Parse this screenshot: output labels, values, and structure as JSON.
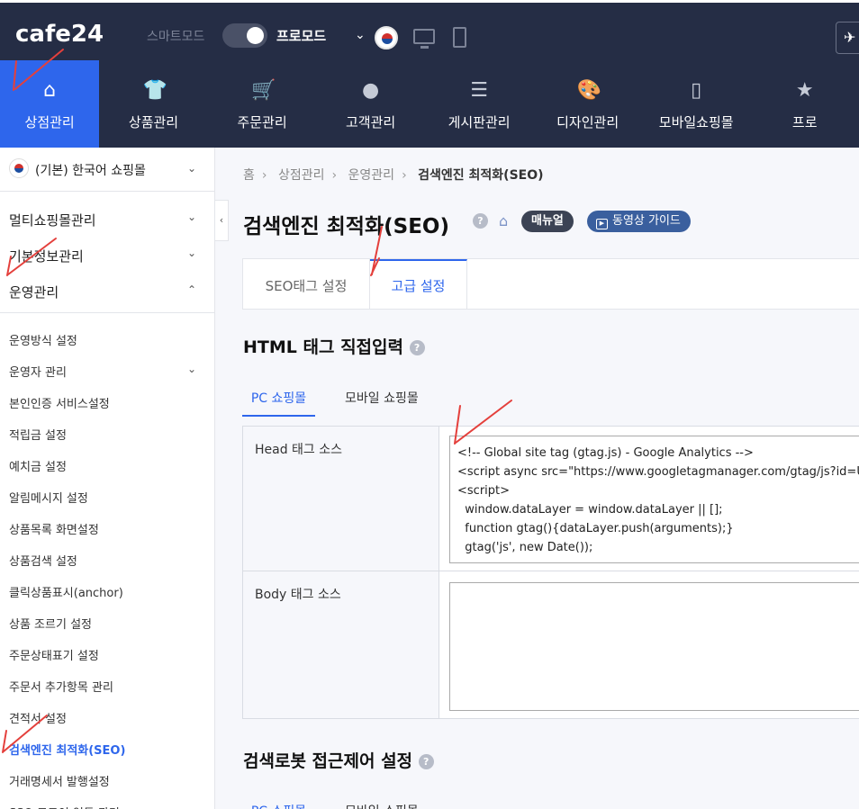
{
  "topbar": {
    "logo": "cafe24",
    "smart_mode": "스마트모드",
    "pro_mode": "프로모드",
    "caret": "⌄",
    "right_btn": "✈"
  },
  "nav": [
    {
      "label": "상점관리",
      "icon": "store-icon",
      "glyph": "⌂"
    },
    {
      "label": "상품관리",
      "icon": "tshirt-icon",
      "glyph": "👕"
    },
    {
      "label": "주문관리",
      "icon": "cart-icon",
      "glyph": "🛒"
    },
    {
      "label": "고객관리",
      "icon": "user-icon",
      "glyph": "●"
    },
    {
      "label": "게시판관리",
      "icon": "board-icon",
      "glyph": "☰"
    },
    {
      "label": "디자인관리",
      "icon": "palette-icon",
      "glyph": "🎨"
    },
    {
      "label": "모바일쇼핑몰",
      "icon": "mobile-icon",
      "glyph": "▯"
    },
    {
      "label": "프로",
      "icon": "star-icon",
      "glyph": "★"
    }
  ],
  "sidebar": {
    "shop_label": "(기본) 한국어 쇼핑몰",
    "sections": [
      "멀티쇼핑몰관리",
      "기본정보관리",
      "운영관리"
    ],
    "items": [
      "운영방식 설정",
      "운영자 관리",
      "본인인증 서비스설정",
      "적립금 설정",
      "예치금 설정",
      "알림메시지 설정",
      "상품목록 화면설정",
      "상품검색 설정",
      "클릭상품표시(anchor)",
      "상품 조르기 설정",
      "주문상태표기 설정",
      "주문서 추가항목 관리",
      "견적서 설정",
      "검색엔진 최적화(SEO)",
      "거래명세서 발행설정",
      "SSO 로그인 연동 관리"
    ],
    "collapse": "‹"
  },
  "breadcrumb": [
    "홈",
    "상점관리",
    "운영관리",
    "검색엔진 최적화(SEO)"
  ],
  "page": {
    "title": "검색엔진 최적화(SEO)",
    "manual": "매뉴얼",
    "video_guide": "동영상 가이드",
    "help": "?"
  },
  "tabs": [
    "SEO태그 설정",
    "고급 설정"
  ],
  "html_section": {
    "title": "HTML 태그 직접입력",
    "subtabs": [
      "PC 쇼핑몰",
      "모바일 쇼핑몰"
    ],
    "head_label": "Head 태그 소스",
    "head_code": "<!-- Global site tag (gtag.js) - Google Analytics -->\n<script async src=\"https://www.googletagmanager.com/gtag/js?id=U\n<script>\n  window.dataLayer = window.dataLayer || [];\n  function gtag(){dataLayer.push(arguments);}\n  gtag('js', new Date());",
    "body_label": "Body 태그 소스",
    "body_code": ""
  },
  "robot_section": {
    "title": "검색로봇 접근제어 설정",
    "subtabs": [
      "PC 쇼핑몰",
      "모바일 쇼핑몰"
    ]
  },
  "colors": {
    "topbar": "#252d45",
    "accent": "#2e66ec",
    "annotation": "#e4403c"
  }
}
